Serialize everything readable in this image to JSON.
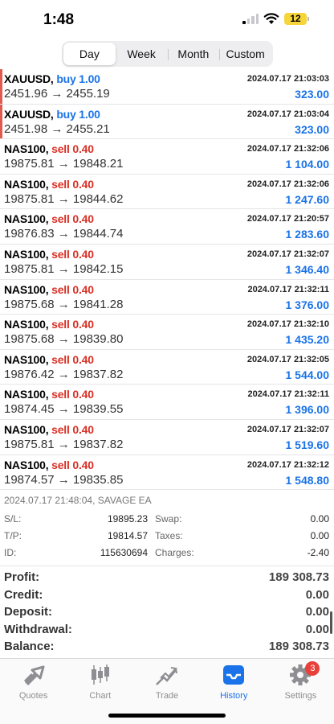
{
  "status": {
    "time": "1:48",
    "battery": "12"
  },
  "periods": [
    "Day",
    "Week",
    "Month",
    "Custom"
  ],
  "active_period": "Day",
  "deals": [
    {
      "symbol": "XAUUSD,",
      "side": "buy",
      "volume": "buy 1.00",
      "time": "2024.07.17 21:03:03",
      "prices": "2451.96 → 2455.19",
      "profit": "323.00"
    },
    {
      "symbol": "XAUUSD,",
      "side": "buy",
      "volume": "buy 1.00",
      "time": "2024.07.17 21:03:04",
      "prices": "2451.98 → 2455.21",
      "profit": "323.00"
    },
    {
      "symbol": "NAS100,",
      "side": "sell",
      "volume": "sell 0.40",
      "time": "2024.07.17 21:32:06",
      "prices": "19875.81 → 19848.21",
      "profit": "1 104.00"
    },
    {
      "symbol": "NAS100,",
      "side": "sell",
      "volume": "sell 0.40",
      "time": "2024.07.17 21:32:06",
      "prices": "19875.81 → 19844.62",
      "profit": "1 247.60"
    },
    {
      "symbol": "NAS100,",
      "side": "sell",
      "volume": "sell 0.40",
      "time": "2024.07.17 21:20:57",
      "prices": "19876.83 → 19844.74",
      "profit": "1 283.60"
    },
    {
      "symbol": "NAS100,",
      "side": "sell",
      "volume": "sell 0.40",
      "time": "2024.07.17 21:32:07",
      "prices": "19875.81 → 19842.15",
      "profit": "1 346.40"
    },
    {
      "symbol": "NAS100,",
      "side": "sell",
      "volume": "sell 0.40",
      "time": "2024.07.17 21:32:11",
      "prices": "19875.68 → 19841.28",
      "profit": "1 376.00"
    },
    {
      "symbol": "NAS100,",
      "side": "sell",
      "volume": "sell 0.40",
      "time": "2024.07.17 21:32:10",
      "prices": "19875.68 → 19839.80",
      "profit": "1 435.20"
    },
    {
      "symbol": "NAS100,",
      "side": "sell",
      "volume": "sell 0.40",
      "time": "2024.07.17 21:32:05",
      "prices": "19876.42 → 19837.82",
      "profit": "1 544.00"
    },
    {
      "symbol": "NAS100,",
      "side": "sell",
      "volume": "sell 0.40",
      "time": "2024.07.17 21:32:11",
      "prices": "19874.45 → 19839.55",
      "profit": "1 396.00"
    },
    {
      "symbol": "NAS100,",
      "side": "sell",
      "volume": "sell 0.40",
      "time": "2024.07.17 21:32:07",
      "prices": "19875.81 → 19837.82",
      "profit": "1 519.60"
    },
    {
      "symbol": "NAS100,",
      "side": "sell",
      "volume": "sell 0.40",
      "time": "2024.07.17 21:32:12",
      "prices": "19874.57 → 19835.85",
      "profit": "1 548.80"
    }
  ],
  "detail": {
    "header": "2024.07.17 21:48:04, SAVAGE EA",
    "rows": [
      {
        "l1": "S/L:",
        "v1": "19895.23",
        "l2": "Swap:",
        "v2": "0.00"
      },
      {
        "l1": "T/P:",
        "v1": "19814.57",
        "l2": "Taxes:",
        "v2": "0.00"
      },
      {
        "l1": "ID:",
        "v1": "115630694",
        "l2": "Charges:",
        "v2": "-2.40"
      }
    ]
  },
  "summary": [
    {
      "label": "Profit:",
      "value": "189 308.73"
    },
    {
      "label": "Credit:",
      "value": "0.00"
    },
    {
      "label": "Deposit:",
      "value": "0.00"
    },
    {
      "label": "Withdrawal:",
      "value": "0.00"
    },
    {
      "label": "Balance:",
      "value": "189 308.73"
    }
  ],
  "tabs": [
    {
      "label": "Quotes",
      "icon": "quotes-icon"
    },
    {
      "label": "Chart",
      "icon": "candlestick-icon"
    },
    {
      "label": "Trade",
      "icon": "trade-icon"
    },
    {
      "label": "History",
      "icon": "inbox-icon"
    },
    {
      "label": "Settings",
      "icon": "gear-icon",
      "badge": "3"
    }
  ],
  "active_tab": "History",
  "colors": {
    "buy": "#1a73e8",
    "sell": "#d93025",
    "accent": "#1a73e8",
    "badge": "#e8403a"
  }
}
